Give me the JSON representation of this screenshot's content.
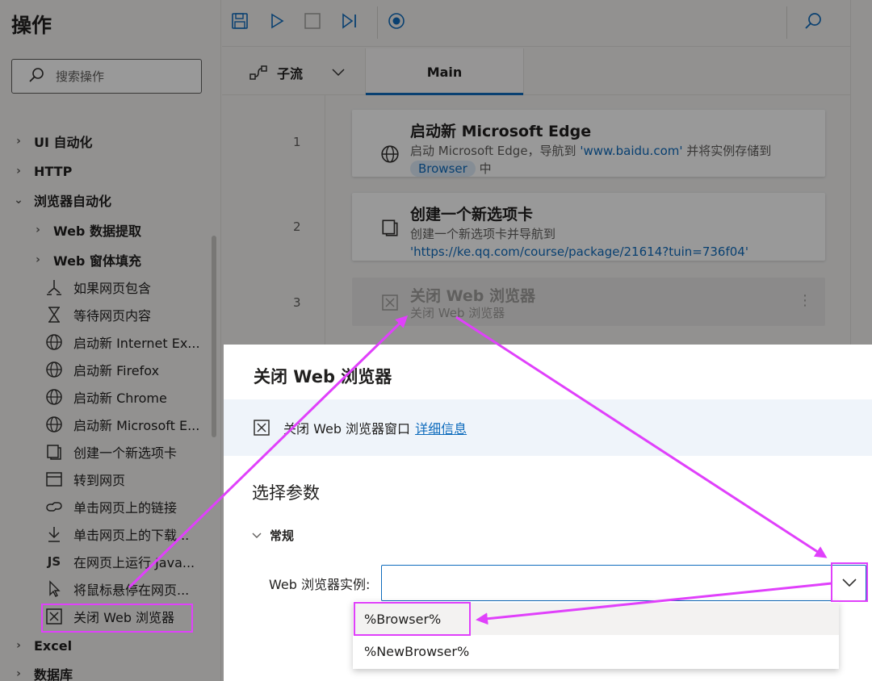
{
  "actions_pane": {
    "title": "操作",
    "search_placeholder": "搜索操作",
    "items": [
      {
        "label": "UI 自动化",
        "level": 0,
        "expander": "collapsed"
      },
      {
        "label": "HTTP",
        "level": 0,
        "expander": "collapsed"
      },
      {
        "label": "浏览器自动化",
        "level": 0,
        "expander": "expanded"
      },
      {
        "label": "Web 数据提取",
        "level": 1,
        "expander": "collapsed"
      },
      {
        "label": "Web 窗体填充",
        "level": 1,
        "expander": "collapsed"
      },
      {
        "label": "如果网页包含",
        "level": 2,
        "icon": "branch-icon"
      },
      {
        "label": "等待网页内容",
        "level": 2,
        "icon": "hourglass-icon"
      },
      {
        "label": "启动新 Internet Ex...",
        "level": 2,
        "icon": "globe-icon"
      },
      {
        "label": "启动新 Firefox",
        "level": 2,
        "icon": "globe-icon"
      },
      {
        "label": "启动新 Chrome",
        "level": 2,
        "icon": "globe-icon"
      },
      {
        "label": "启动新 Microsoft E...",
        "level": 2,
        "icon": "globe-icon"
      },
      {
        "label": "创建一个新选项卡",
        "level": 2,
        "icon": "new-tab-icon"
      },
      {
        "label": "转到网页",
        "level": 2,
        "icon": "browser-window-icon"
      },
      {
        "label": "单击网页上的链接",
        "level": 2,
        "icon": "link-icon"
      },
      {
        "label": "单击网页上的下载...",
        "level": 2,
        "icon": "download-icon"
      },
      {
        "label": "在网页上运行 Java...",
        "level": 2,
        "icon": "js-icon"
      },
      {
        "label": "将鼠标悬停在网页...",
        "level": 2,
        "icon": "cursor-icon"
      },
      {
        "label": "关闭 Web 浏览器",
        "level": 2,
        "icon": "close-box-icon",
        "highlighted": true
      },
      {
        "label": "Excel",
        "level": 0,
        "expander": "collapsed"
      },
      {
        "label": "数据库",
        "level": 0,
        "expander": "collapsed"
      }
    ]
  },
  "toolbar": {
    "buttons": [
      "save-icon",
      "run-icon",
      "stop-icon",
      "step-icon",
      "record-icon",
      "search-icon"
    ]
  },
  "tabs": {
    "subflow_label": "子流",
    "main_label": "Main"
  },
  "flow": {
    "steps": [
      {
        "line": "1",
        "title": "启动新 Microsoft Edge",
        "desc_pre": "启动 Microsoft Edge，导航到 ",
        "desc_link": "'www.baidu.com'",
        "desc_mid": " 并将实例存储到 ",
        "desc_var": "Browser",
        "desc_post": " 中"
      },
      {
        "line": "2",
        "title": "创建一个新选项卡",
        "desc_pre": "创建一个新选项卡并导航到 ",
        "desc_link": "'https://ke.qq.com/course/package/21614?tuin=736f04'"
      },
      {
        "line": "3",
        "title": "关闭 Web 浏览器",
        "desc": "关闭 Web 浏览器",
        "disabled": true
      }
    ]
  },
  "dialog": {
    "title": "关闭 Web 浏览器",
    "info_text": "关闭 Web 浏览器窗口",
    "info_link": "详细信息",
    "section_title": "选择参数",
    "group_label": "常规",
    "param_label": "Web 浏览器实例:",
    "param_value": "",
    "options": [
      "%Browser%",
      "%NewBrowser%"
    ],
    "selected_option": "%Browser%"
  },
  "colors": {
    "accent": "#0f6cbd",
    "annotation": "#e040fb",
    "overlay": "rgba(0,0,0,0.40)"
  }
}
